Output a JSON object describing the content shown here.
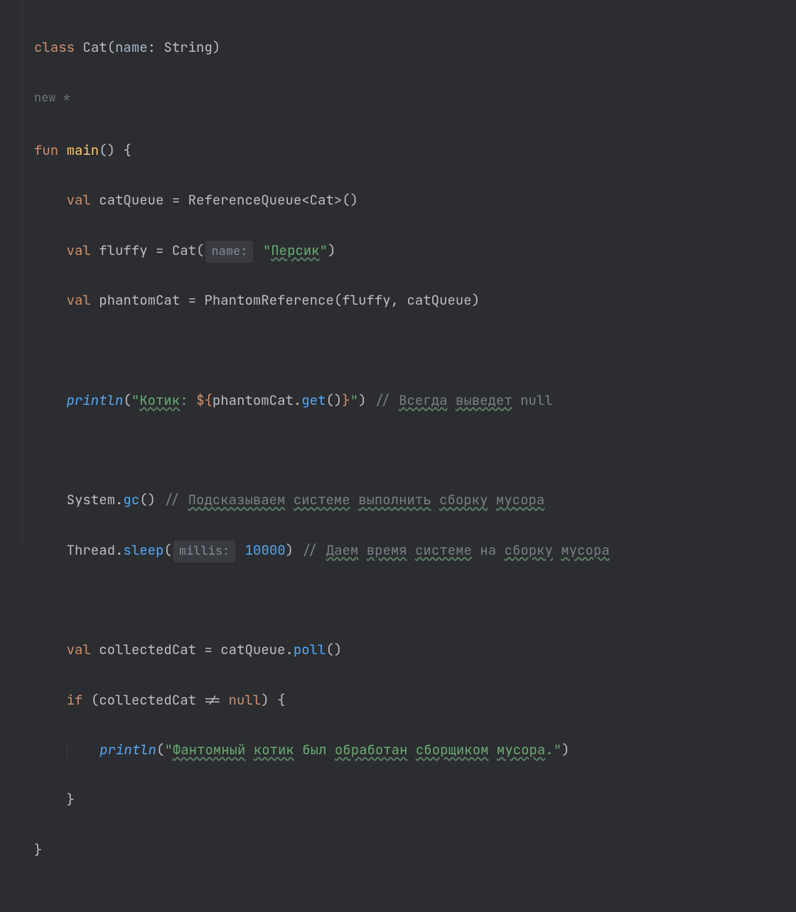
{
  "marker": "new *",
  "code": {
    "l1": {
      "kw": "class",
      "name": "Cat",
      "param": "name",
      "ptype": "String"
    },
    "l3": {
      "kw": "fun",
      "name": "main"
    },
    "l4": {
      "kw": "val",
      "name": "catQueue",
      "eq": "=",
      "rt": "ReferenceQueue",
      "gen": "Cat"
    },
    "l5": {
      "kw": "val",
      "name": "fluffy",
      "eq": "=",
      "ctor": "Cat",
      "hint": "name:",
      "str": "Персик"
    },
    "l6": {
      "kw": "val",
      "name": "phantomCat",
      "eq": "=",
      "ctor": "PhantomReference",
      "a1": "fluffy",
      "a2": "catQueue"
    },
    "l8": {
      "fn": "println",
      "s1": "Котик",
      "s2": ": ",
      "tpl": "${",
      "expr": "phantomCat.",
      "call": "get",
      "tplc": "}",
      "cmt1": "// ",
      "cmt2": "Всегда",
      "cmt3": "выведет",
      "cmt4": " null"
    },
    "l10": {
      "obj": "System.",
      "call": "gc",
      "cmt1": "// ",
      "cmt2": "Подсказываем",
      "cmt3": "системе",
      "cmt4": "выполнить",
      "cmt5": "сборку",
      "cmt6": "мусора"
    },
    "l11": {
      "obj": "Thread.",
      "call": "sleep",
      "hint": "millis:",
      "num": "10000",
      "cmt1": "// ",
      "cmt2": "Даем",
      "cmt3": "время",
      "cmt4": "системе",
      "cmt5": " на ",
      "cmt6": "сборку",
      "cmt7": "мусора"
    },
    "l13": {
      "kw": "val",
      "name": "collectedCat",
      "eq": "=",
      "obj": "catQueue.",
      "call": "poll"
    },
    "l14": {
      "kw": "if",
      "expr": "collectedCat != ",
      "null": "null"
    },
    "l15": {
      "fn": "println",
      "s1": "Фантомный",
      "s2": "котик",
      "s3": " был ",
      "s4": "обработан",
      "s5": "сборщиком",
      "s6": "мусора",
      "s7": "."
    }
  }
}
